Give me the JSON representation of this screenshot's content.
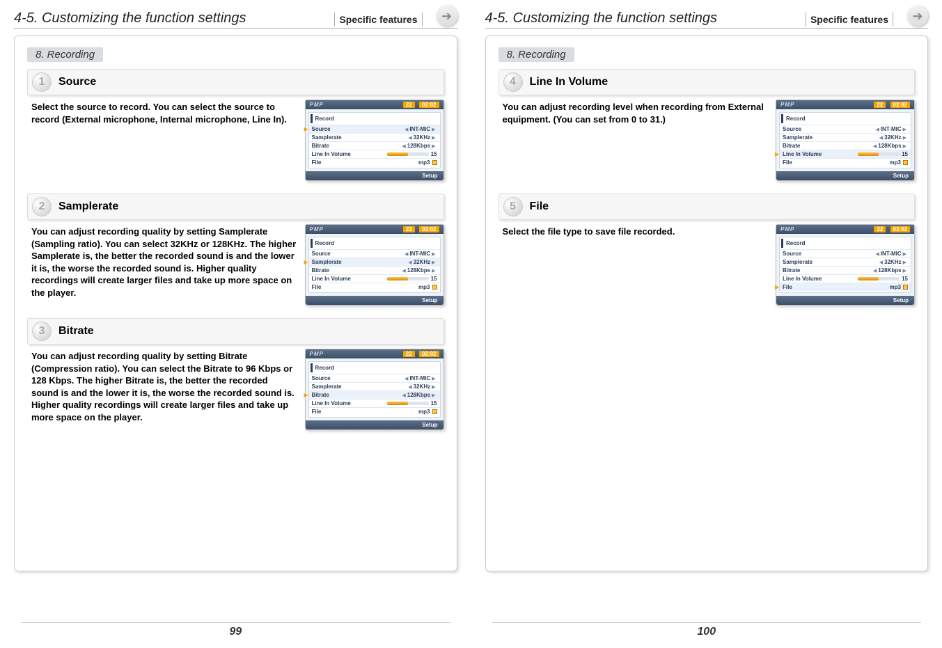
{
  "header": {
    "title": "4-5. Customizing the function settings",
    "subtitle": "Specific features"
  },
  "section_heading": "8. Recording",
  "device_common": {
    "brand": "PMP",
    "battery": "22",
    "time": "02:02",
    "list_title": "Record",
    "footer": "Setup",
    "rows": {
      "source": {
        "label": "Source",
        "value": "INT-MIC"
      },
      "samplerate": {
        "label": "Samplerate",
        "value": "32KHz"
      },
      "bitrate": {
        "label": "Bitrate",
        "value": "128Kbps"
      },
      "linein": {
        "label": "Line In Volume",
        "value": "15"
      },
      "file": {
        "label": "File",
        "value": "mp3"
      }
    }
  },
  "pages": {
    "left": {
      "number": "99",
      "steps": [
        {
          "num": "1",
          "title": "Source",
          "desc": "Select the source to record.\nYou can select the source to record (External microphone, Internal microphone, Line In).",
          "highlight": "source"
        },
        {
          "num": "2",
          "title": "Samplerate",
          "desc": "You can adjust recording quality by setting Samplerate (Sampling ratio).\nYou can select 32KHz or 128KHz.\nThe higher Samplerate is, the better the recorded sound is and the lower it is, the worse the recorded sound is. Higher quality recordings will create larger files and take up more space on the player.",
          "highlight": "samplerate"
        },
        {
          "num": "3",
          "title": "Bitrate",
          "desc": "You can adjust recording quality by setting Bitrate (Compression ratio).\nYou can select the Bitrate to 96 Kbps or 128 Kbps.\nThe higher Bitrate is, the better the recorded sound is and the lower it is, the worse the recorded sound is. Higher quality recordings will create larger files and take up more space on the player.",
          "highlight": "bitrate"
        }
      ]
    },
    "right": {
      "number": "100",
      "steps": [
        {
          "num": "4",
          "title": "Line In Volume",
          "desc": "You can adjust recording level when recording from External equipment.\n(You can set from 0 to 31.)",
          "highlight": "linein"
        },
        {
          "num": "5",
          "title": "File",
          "desc": "Select the file type to save file recorded.",
          "highlight": "file"
        }
      ]
    }
  }
}
